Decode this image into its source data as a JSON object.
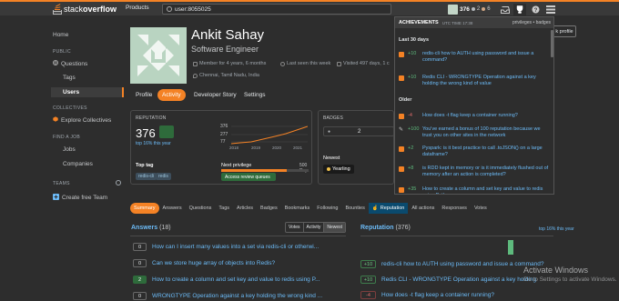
{
  "topbar": {
    "logo_prefix": "stack",
    "logo_suffix": "overflow",
    "products": "Products",
    "search_value": "user:8055025",
    "reputation": "376",
    "silver": "2",
    "bronze": "6"
  },
  "leftnav": {
    "home": "Home",
    "public": "PUBLIC",
    "questions": "Questions",
    "tags": "Tags",
    "users": "Users",
    "collectives": "COLLECTIVES",
    "explore_collectives": "Explore Collectives",
    "find_a_job": "FIND A JOB",
    "jobs": "Jobs",
    "companies": "Companies",
    "teams": "TEAMS",
    "create_free_team": "Create free Team"
  },
  "profile": {
    "name": "Ankit Sahay",
    "title": "Software Engineer",
    "member": "Member for 4 years, 6 months",
    "last_seen": "Last seen this week",
    "visited": "Visited 497 days, 1 c",
    "location": "Chennai, Tamil Nadu, India",
    "edit_button": "k profile"
  },
  "tabs": [
    "Profile",
    "Activity",
    "Developer Story",
    "Settings"
  ],
  "reputation_card": {
    "label": "REPUTATION",
    "value": "376",
    "top": "top 16% this year",
    "y_ticks": [
      "376",
      "277",
      "77"
    ],
    "x_ticks": [
      "2018",
      "2019",
      "2020",
      "2021"
    ],
    "top_tag_label": "Top tag",
    "top_tags": [
      "redis-cli",
      "redis"
    ],
    "next_privilege": "Next privilege",
    "privilege_progress": "500 Rep.",
    "access_review": "Access review queues"
  },
  "badges_card": {
    "label": "BADGES",
    "silver": "2",
    "newest_label": "Newest",
    "newest_badge": "Yearling"
  },
  "subnav": [
    "Summary",
    "Answers",
    "Questions",
    "Tags",
    "Articles",
    "Badges",
    "Bookmarks",
    "Following",
    "Bounties",
    "Reputation",
    "All actions",
    "Responses",
    "Votes"
  ],
  "answers": {
    "title": "Answers",
    "count": "(18)",
    "sort": [
      "Votes",
      "Activity",
      "Newest"
    ],
    "items": [
      {
        "score": "0",
        "title": "How can I insert many values into a set via redis-cli or otherwi..."
      },
      {
        "score": "0",
        "title": "Can we store huge array of objects into Redis?"
      },
      {
        "score": "2",
        "title": "How to create a column and set key and value to redis using P..."
      },
      {
        "score": "0",
        "title": "WRONGTYPE Operation against a key holding the wrong kind ..."
      }
    ]
  },
  "reputation_list": {
    "title": "Reputation",
    "count": "(376)",
    "top": "top 16% this year",
    "items": [
      {
        "delta": "+10",
        "title": "redis-cli how to AUTH using password and issue a command?"
      },
      {
        "delta": "+10",
        "title": "Redis CLI - WRONGTYPE Operation against a key holding"
      },
      {
        "delta": "-4",
        "title": "How does -t flag keep a container running?"
      }
    ]
  },
  "dropdown": {
    "title": "ACHIEVEMENTS",
    "time": "UTC TIME 17:38",
    "links": "privileges • badges",
    "sections": [
      {
        "label": "Last 30 days",
        "items": [
          {
            "score": "+10",
            "color": "#5eba7d",
            "icon": "badge",
            "text": "redis-cli how to AUTH using password and issue a command?"
          },
          {
            "score": "+10",
            "color": "#5eba7d",
            "icon": "badge",
            "text": "Redis CLI - WRONGTYPE Operation against a key holding the wrong kind of value"
          }
        ]
      },
      {
        "label": "Older",
        "items": [
          {
            "score": "-4",
            "color": "#e36c6c",
            "icon": "badge",
            "text": "How does -t flag keep a container running?"
          },
          {
            "score": "+100",
            "color": "#5eba7d",
            "icon": "pen",
            "text": "You've earned a bonus of 100 reputation because we trust you on other sites in the network"
          },
          {
            "score": "+2",
            "color": "#5eba7d",
            "icon": "badge",
            "text": "Pyspark: is it best practice to call .toJSON() on a large dataframe?"
          },
          {
            "score": "+8",
            "color": "#5eba7d",
            "icon": "badge",
            "text": "is RDD kept in memory or is it immediately flushed out of memory after an action is completed?"
          },
          {
            "score": "+35",
            "color": "#5eba7d",
            "icon": "badge",
            "text": "How to create a column and set key and value to redis using Python"
          }
        ]
      }
    ]
  },
  "watermark": {
    "line1": "Activate Windows",
    "line2": "Go to Settings to activate Windows."
  }
}
